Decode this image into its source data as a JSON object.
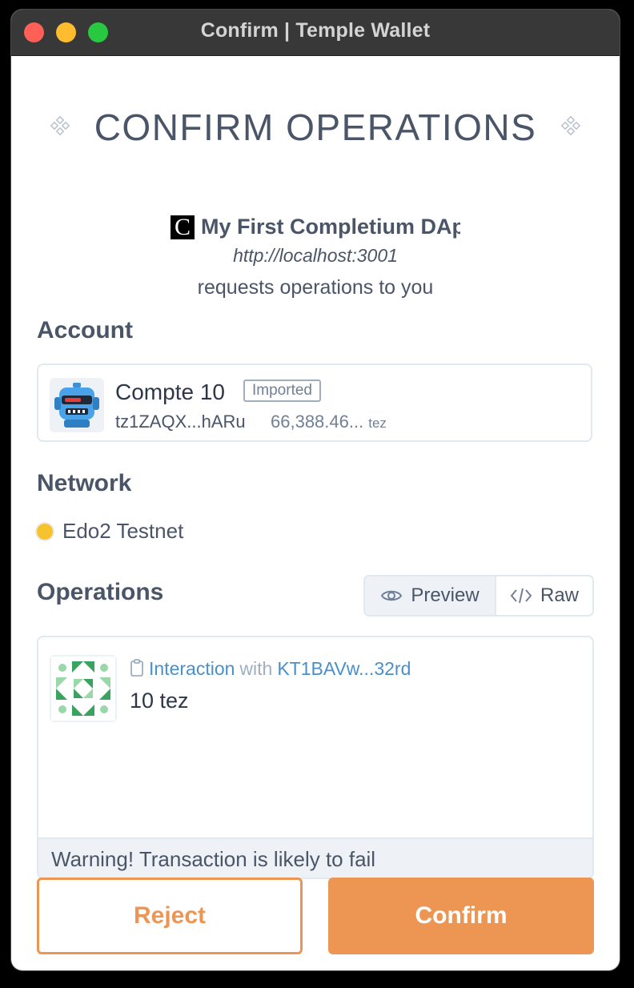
{
  "window": {
    "title": "Confirm | Temple Wallet"
  },
  "heading": "CONFIRM OPERATIONS",
  "app": {
    "logo_letter": "C",
    "name": "My First Completium DApp",
    "url": "http://localhost:3001",
    "request_text": "requests operations to you"
  },
  "account": {
    "section_label": "Account",
    "name": "Compte 10",
    "badge": "Imported",
    "address": "tz1ZAQX...hARu",
    "balance": "66,388.46...",
    "unit": "tez"
  },
  "network": {
    "section_label": "Network",
    "name": "Edo2 Testnet",
    "dot_color": "#f6c32f"
  },
  "operations": {
    "section_label": "Operations",
    "tabs": {
      "preview": "Preview",
      "raw": "Raw"
    },
    "item": {
      "type": "Interaction",
      "with": "with",
      "target": "KT1BAVw...32rd",
      "amount": "10 tez"
    },
    "warning": "Warning! Transaction is likely to fail"
  },
  "buttons": {
    "reject": "Reject",
    "confirm": "Confirm"
  },
  "colors": {
    "accent": "#ed9654",
    "link": "#4a90c8",
    "text": "#4a5568"
  }
}
